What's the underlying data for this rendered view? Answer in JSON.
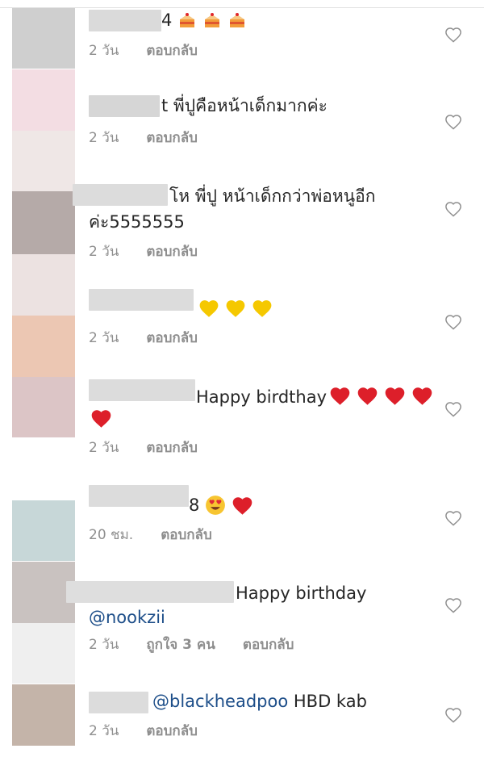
{
  "comments": [
    {
      "text": "4",
      "emoji": [
        "cake-icon",
        "cake-icon",
        "cake-icon"
      ],
      "time": "2 วัน",
      "reply": "ตอบกลับ"
    },
    {
      "text": "t พี่ปูคือหน้าเด็กมากค่ะ",
      "time": "2 วัน",
      "reply": "ตอบกลับ"
    },
    {
      "text_line1": "โห พี่ปู หน้าเด็กกว่าพ่อหนูอีก",
      "text_line2": "ค่ะ5555555",
      "time": "2 วัน",
      "reply": "ตอบกลับ"
    },
    {
      "text": "",
      "emoji": [
        "yellow-heart-icon",
        "yellow-heart-icon",
        "yellow-heart-icon"
      ],
      "time": "2 วัน",
      "reply": "ตอบกลับ"
    },
    {
      "text": "Happy birdthay",
      "emoji": [
        "red-heart-icon",
        "red-heart-icon",
        "red-heart-icon",
        "red-heart-icon",
        "red-heart-icon"
      ],
      "time": "2 วัน",
      "reply": "ตอบกลับ"
    },
    {
      "text": "8",
      "emoji": [
        "heart-eyes-icon",
        "red-heart-icon"
      ],
      "time": "20 ชม.",
      "reply": "ตอบกลับ"
    },
    {
      "text": "Happy birthday",
      "mention": "@nookzii",
      "time": "2 วัน",
      "likes": "ถูกใจ 3 คน",
      "reply": "ตอบกลับ"
    },
    {
      "mention": "@blackheadpoo",
      "text": " HBD kab",
      "time": "2 วัน",
      "reply": "ตอบกลับ"
    }
  ],
  "colors": {
    "text": "#262626",
    "meta": "#8e8e8e",
    "mention": "#1d4e89",
    "red_heart": "#dd1f2a",
    "yellow_heart": "#f5c800"
  }
}
